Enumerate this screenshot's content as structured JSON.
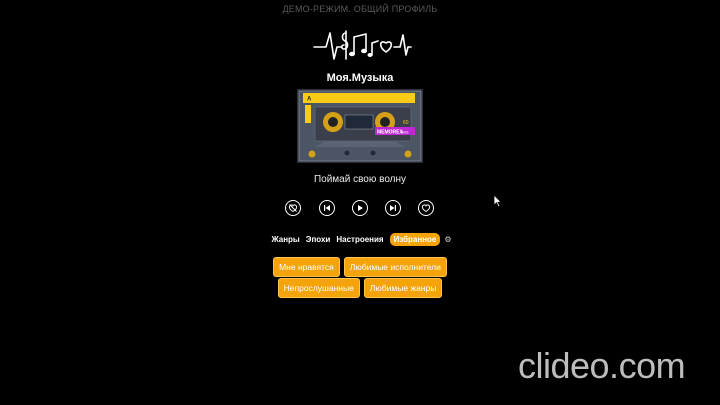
{
  "banner": "ДЕМО-РЕЖИМ. ОБЩИЙ ПРОФИЛЬ",
  "app_title": "Моя.Музыка",
  "cassette": {
    "side_label": "A",
    "brand": "MEMOREX",
    "model": "dBS",
    "length": "60"
  },
  "tagline": "Поймай свою волну",
  "controls": [
    {
      "name": "dislike-heart-icon"
    },
    {
      "name": "previous-track-icon"
    },
    {
      "name": "play-icon"
    },
    {
      "name": "next-track-icon"
    },
    {
      "name": "like-heart-icon"
    }
  ],
  "tabs": {
    "genres": "Жанры",
    "eras": "Эпохи",
    "moods": "Настроения",
    "favorites": "Избранное",
    "settings_glyph": "⚙"
  },
  "chips": {
    "liked": "Мне нравятся",
    "favorite_artists": "Любимые исполнители",
    "unplayed": "Непрослушанные",
    "favorite_genres": "Любимые жанры"
  },
  "watermark": "clideo.com",
  "colors": {
    "accent": "#f5a30a",
    "background": "#000000",
    "text": "#ffffff"
  }
}
